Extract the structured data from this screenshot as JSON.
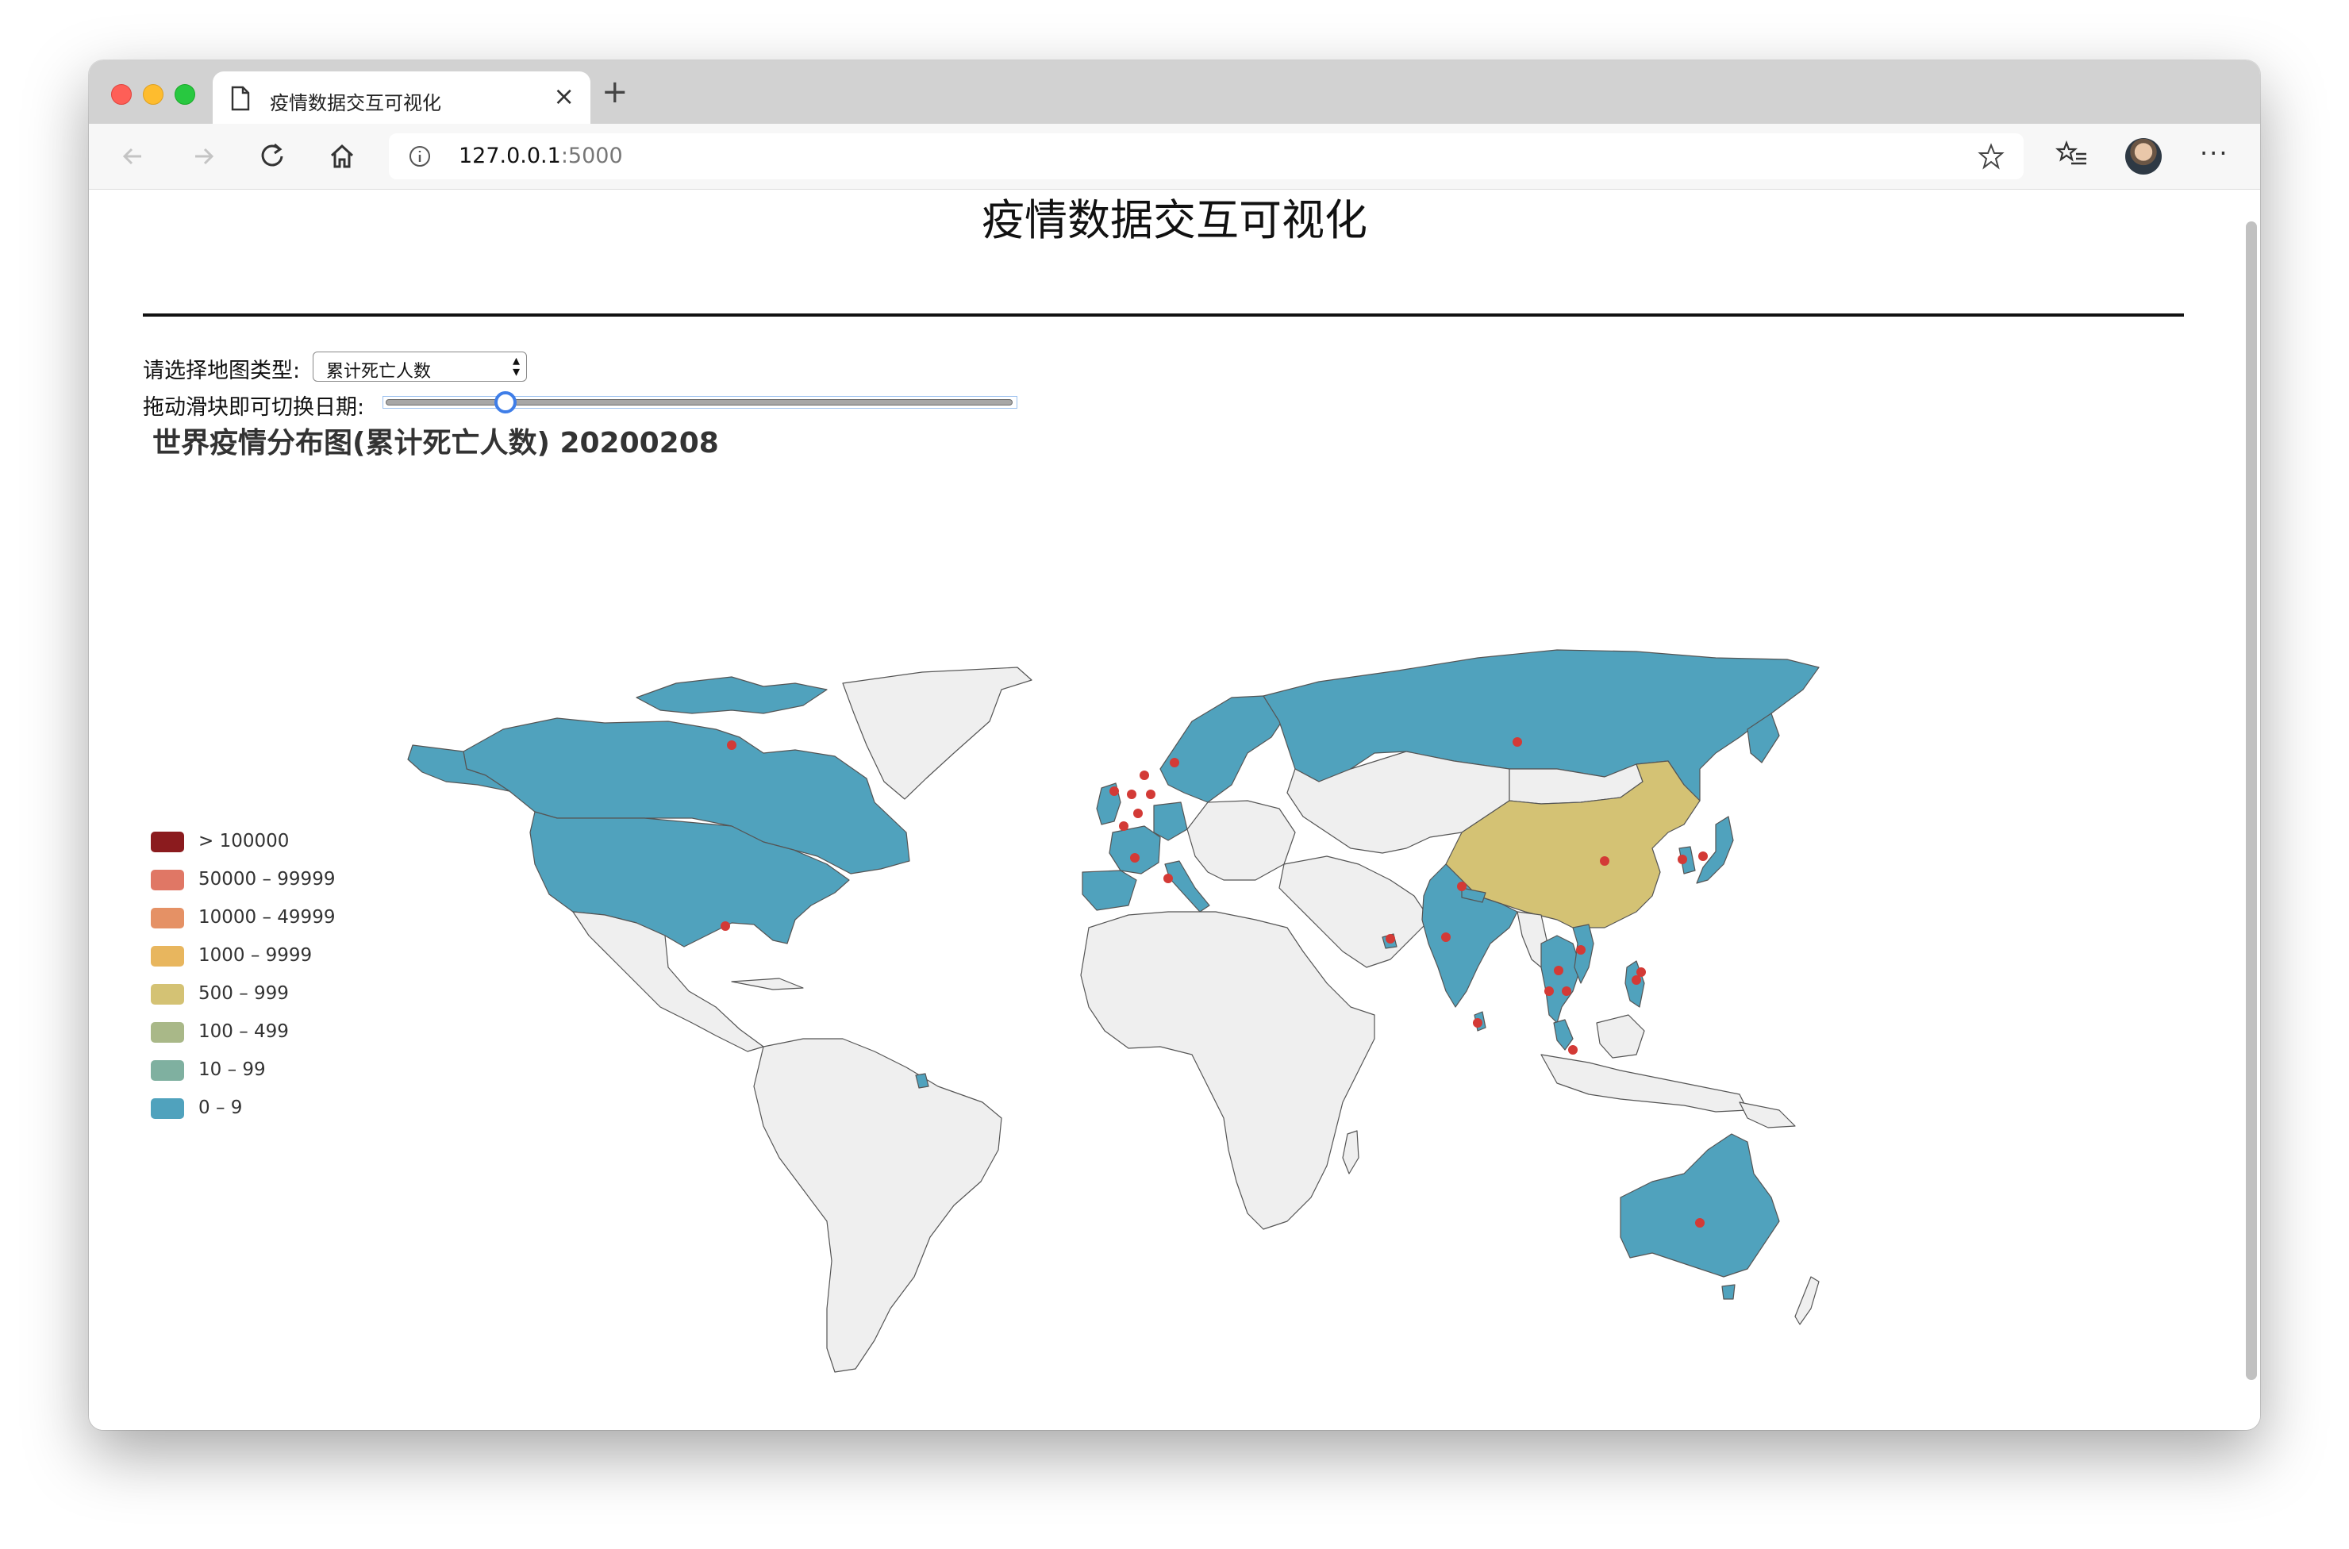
{
  "browser": {
    "tab_title": "疫情数据交互可视化",
    "new_tab_symbol": "+",
    "close_symbol": "×",
    "url_host": "127.0.0.1",
    "url_port": ":5000",
    "more_symbol": "···"
  },
  "page": {
    "title": "疫情数据交互可视化",
    "map_type_label": "请选择地图类型:",
    "map_type_value": "累计死亡人数",
    "slider_label": "拖动滑块即可切换日期:",
    "slider_position": 0.18,
    "map_title": "世界疫情分布图(累计死亡人数) 20200208"
  },
  "legend": [
    {
      "label": "> 100000",
      "color": "#8b1b1e"
    },
    {
      "label": "50000 – 99999",
      "color": "#e07765"
    },
    {
      "label": "10000 – 49999",
      "color": "#e59165"
    },
    {
      "label": "1000 – 9999",
      "color": "#e8b65e"
    },
    {
      "label": "500 – 999",
      "color": "#d4c274"
    },
    {
      "label": "100 – 499",
      "color": "#a9b888"
    },
    {
      "label": "10 – 99",
      "color": "#7fb0a0"
    },
    {
      "label": "0 – 9",
      "color": "#50a2bd"
    }
  ],
  "colors": {
    "no_data": "#efefef",
    "marker": "#d33a36",
    "border": "#555555"
  }
}
